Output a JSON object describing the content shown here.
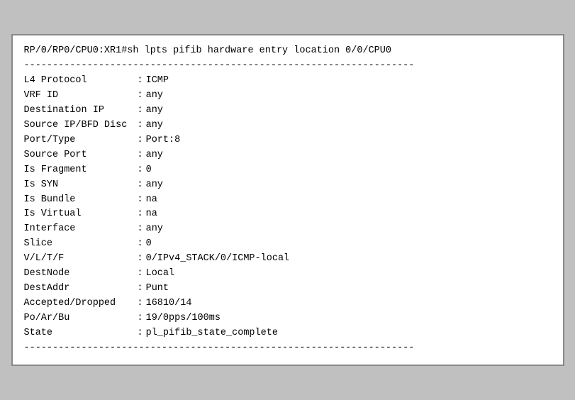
{
  "terminal": {
    "prompt_line": "RP/0/RP0/CPU0:XR1#sh lpts pifib hardware entry location 0/0/CPU0",
    "divider": "--------------------------------------------------------------------",
    "fields": [
      {
        "name": "L4 Protocol",
        "sep": ":",
        "value": "ICMP"
      },
      {
        "name": "VRF ID",
        "sep": ":",
        "value": "any"
      },
      {
        "name": "Destination IP",
        "sep": ":",
        "value": "any"
      },
      {
        "name": "Source IP/BFD Disc",
        "sep": ":",
        "value": "any"
      },
      {
        "name": "Port/Type",
        "sep": ":",
        "value": "Port:8"
      },
      {
        "name": "Source Port",
        "sep": ":",
        "value": "any"
      },
      {
        "name": "Is Fragment",
        "sep": ":",
        "value": "0"
      },
      {
        "name": "Is SYN",
        "sep": ":",
        "value": "any"
      },
      {
        "name": "Is Bundle",
        "sep": ":",
        "value": "na"
      },
      {
        "name": "Is Virtual",
        "sep": ":",
        "value": "na"
      },
      {
        "name": "Interface",
        "sep": ":",
        "value": "any"
      },
      {
        "name": "Slice",
        "sep": ":",
        "value": "0"
      },
      {
        "name": "V/L/T/F",
        "sep": ":",
        "value": "0/IPv4_STACK/0/ICMP-local"
      },
      {
        "name": "DestNode",
        "sep": ":",
        "value": "Local"
      },
      {
        "name": "DestAddr",
        "sep": ":",
        "value": "Punt"
      },
      {
        "name": "Accepted/Dropped",
        "sep": ":",
        "value": "16810/14"
      },
      {
        "name": "Po/Ar/Bu",
        "sep": ":",
        "value": "19/0pps/100ms"
      },
      {
        "name": "State",
        "sep": ":",
        "value": "pl_pifib_state_complete"
      }
    ]
  }
}
